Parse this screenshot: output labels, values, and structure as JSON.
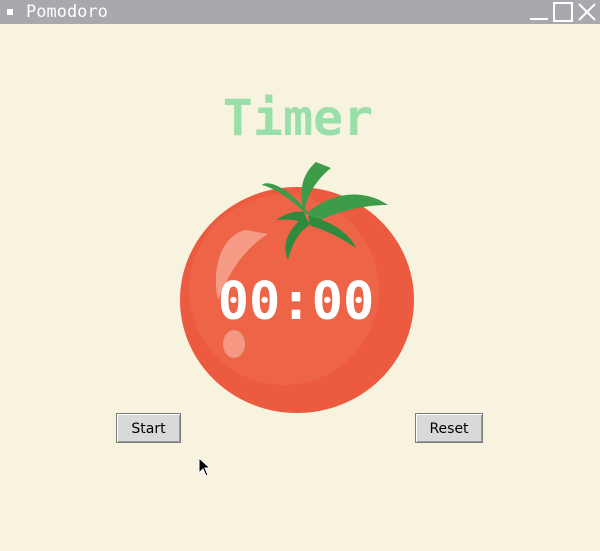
{
  "window": {
    "title": "Pomodoro"
  },
  "main": {
    "heading": "Timer",
    "time": "00:00",
    "start_label": "Start",
    "reset_label": "Reset"
  },
  "colors": {
    "background": "#f7f3de",
    "heading": "#98dfa9",
    "tomato": "#ec5a3f",
    "leaves": "#3d9b4a"
  }
}
